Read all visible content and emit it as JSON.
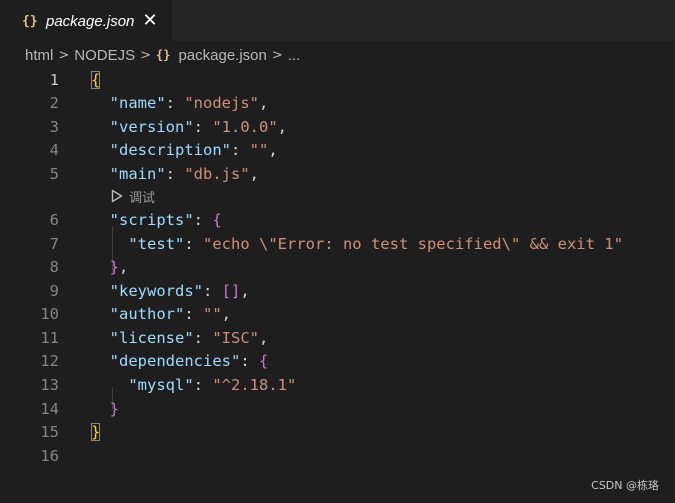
{
  "tab": {
    "icon": "json-braces-icon",
    "icon_text": "{}",
    "title": "package.json",
    "close_glyph": "✕"
  },
  "breadcrumb": {
    "items": [
      "html",
      "NODEJS",
      "package.json",
      "..."
    ],
    "file_icon_text": "{}",
    "separator": ">"
  },
  "editor": {
    "line_numbers": [
      "1",
      "2",
      "3",
      "4",
      "5",
      "6",
      "7",
      "8",
      "9",
      "10",
      "11",
      "12",
      "13",
      "14",
      "15",
      "16"
    ],
    "codelens": {
      "label": "调试",
      "icon": "play-outline-icon"
    },
    "lines": [
      [
        {
          "t": "{",
          "c": "br1"
        }
      ],
      [
        {
          "t": "  "
        },
        {
          "t": "\"name\"",
          "c": "key"
        },
        {
          "t": ": ",
          "c": "punc"
        },
        {
          "t": "\"nodejs\"",
          "c": "str"
        },
        {
          "t": ",",
          "c": "punc"
        }
      ],
      [
        {
          "t": "  "
        },
        {
          "t": "\"version\"",
          "c": "key"
        },
        {
          "t": ": ",
          "c": "punc"
        },
        {
          "t": "\"1.0.0\"",
          "c": "str"
        },
        {
          "t": ",",
          "c": "punc"
        }
      ],
      [
        {
          "t": "  "
        },
        {
          "t": "\"description\"",
          "c": "key"
        },
        {
          "t": ": ",
          "c": "punc"
        },
        {
          "t": "\"\"",
          "c": "str"
        },
        {
          "t": ",",
          "c": "punc"
        }
      ],
      [
        {
          "t": "  "
        },
        {
          "t": "\"main\"",
          "c": "key"
        },
        {
          "t": ": ",
          "c": "punc"
        },
        {
          "t": "\"db.js\"",
          "c": "str"
        },
        {
          "t": ",",
          "c": "punc"
        }
      ],
      [
        {
          "t": "  "
        },
        {
          "t": "\"scripts\"",
          "c": "key"
        },
        {
          "t": ": ",
          "c": "punc"
        },
        {
          "t": "{",
          "c": "br2"
        }
      ],
      [
        {
          "t": "    "
        },
        {
          "t": "\"test\"",
          "c": "key"
        },
        {
          "t": ": ",
          "c": "punc"
        },
        {
          "t": "\"echo \\\"Error: no test specified\\\" && exit 1\"",
          "c": "str"
        }
      ],
      [
        {
          "t": "  "
        },
        {
          "t": "}",
          "c": "br2"
        },
        {
          "t": ",",
          "c": "punc"
        }
      ],
      [
        {
          "t": "  "
        },
        {
          "t": "\"keywords\"",
          "c": "key"
        },
        {
          "t": ": ",
          "c": "punc"
        },
        {
          "t": "[]",
          "c": "br2"
        },
        {
          "t": ",",
          "c": "punc"
        }
      ],
      [
        {
          "t": "  "
        },
        {
          "t": "\"author\"",
          "c": "key"
        },
        {
          "t": ": ",
          "c": "punc"
        },
        {
          "t": "\"\"",
          "c": "str"
        },
        {
          "t": ",",
          "c": "punc"
        }
      ],
      [
        {
          "t": "  "
        },
        {
          "t": "\"license\"",
          "c": "key"
        },
        {
          "t": ": ",
          "c": "punc"
        },
        {
          "t": "\"ISC\"",
          "c": "str"
        },
        {
          "t": ",",
          "c": "punc"
        }
      ],
      [
        {
          "t": "  "
        },
        {
          "t": "\"dependencies\"",
          "c": "key"
        },
        {
          "t": ": ",
          "c": "punc"
        },
        {
          "t": "{",
          "c": "br2"
        }
      ],
      [
        {
          "t": "    "
        },
        {
          "t": "\"mysql\"",
          "c": "key"
        },
        {
          "t": ": ",
          "c": "punc"
        },
        {
          "t": "\"^2.18.1\"",
          "c": "str"
        }
      ],
      [
        {
          "t": "  "
        },
        {
          "t": "}",
          "c": "br2"
        }
      ],
      [
        {
          "t": "}",
          "c": "br1"
        }
      ],
      []
    ]
  },
  "watermark": "CSDN @栋珞",
  "colors": {
    "background": "#1e1e1e",
    "key": "#9cdcfe",
    "string": "#ce9178",
    "bracket_level1": "#ffd700",
    "bracket_level2": "#da70d6",
    "json_icon": "#e2c08d"
  }
}
